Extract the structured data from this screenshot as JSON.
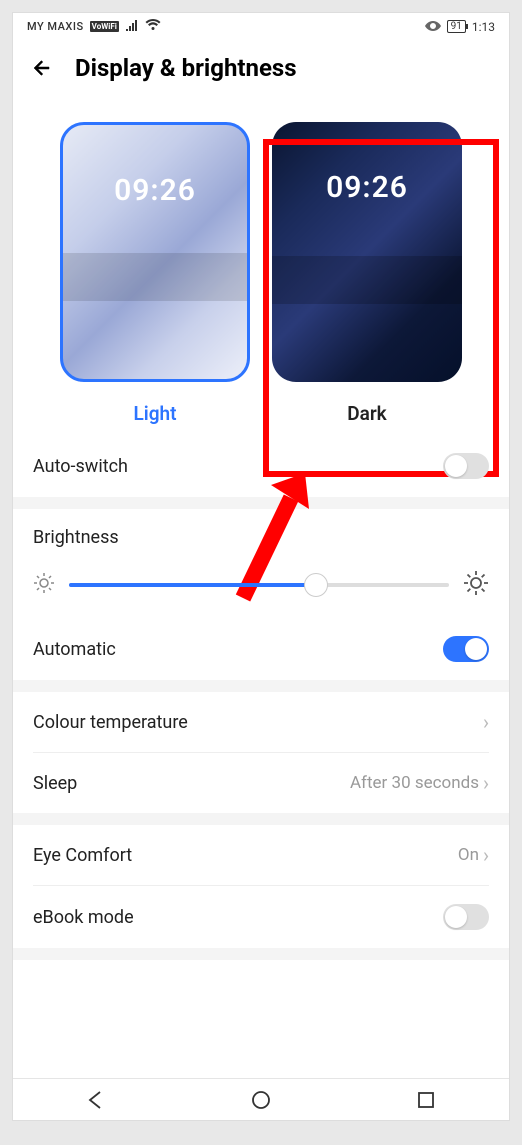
{
  "status": {
    "carrier": "MY MAXIS",
    "vowifi": "VoWiFi",
    "battery": "91",
    "time": "1:13"
  },
  "header": {
    "title": "Display & brightness"
  },
  "themes": {
    "light": {
      "label": "Light",
      "preview_time": "09:26"
    },
    "dark": {
      "label": "Dark",
      "preview_time": "09:26"
    }
  },
  "rows": {
    "auto_switch": "Auto-switch",
    "brightness": "Brightness",
    "automatic": "Automatic",
    "colour_temperature": "Colour temperature",
    "sleep": {
      "label": "Sleep",
      "value": "After 30 seconds"
    },
    "eye_comfort": {
      "label": "Eye Comfort",
      "value": "On"
    },
    "ebook_mode": "eBook mode"
  },
  "toggles": {
    "auto_switch": false,
    "automatic": true,
    "ebook_mode": false
  },
  "slider": {
    "brightness_percent": 65
  }
}
